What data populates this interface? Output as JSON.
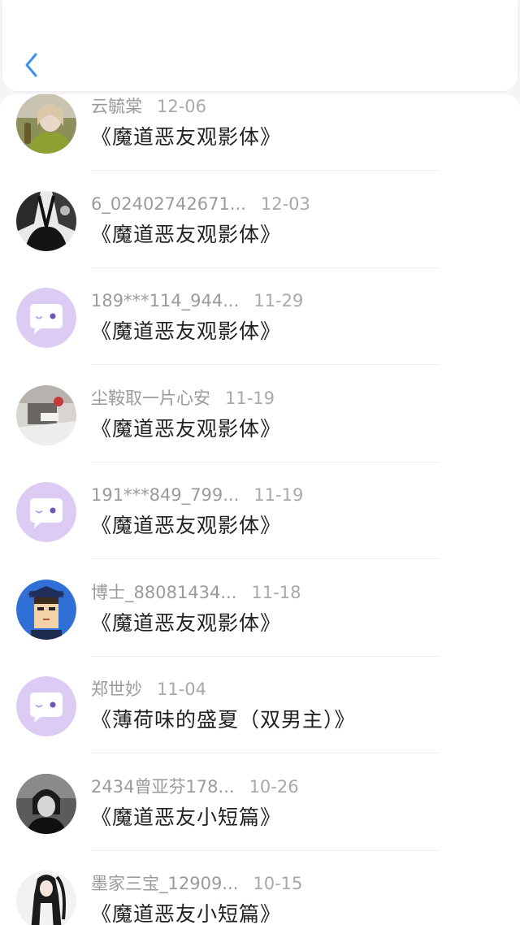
{
  "header": {
    "back_icon": "chevron-left-icon",
    "accent": "#3d8ff0"
  },
  "comments": [
    {
      "user": "云毓棠",
      "date": "12-06",
      "title": "《魔道恶友观影体》",
      "avatar": "photo-woman"
    },
    {
      "user": "6_02402742671...",
      "date": "12-03",
      "title": "《魔道恶友观影体》",
      "avatar": "photo-bw"
    },
    {
      "user": "189***114_944...",
      "date": "11-29",
      "title": "《魔道恶友观影体》",
      "avatar": "default"
    },
    {
      "user": "尘鞍取一片心安",
      "date": "11-19",
      "title": "《魔道恶友观影体》",
      "avatar": "photo-room"
    },
    {
      "user": "191***849_799...",
      "date": "11-19",
      "title": "《魔道恶友观影体》",
      "avatar": "default"
    },
    {
      "user": "博士_88081434...",
      "date": "11-18",
      "title": "《魔道恶友观影体》",
      "avatar": "pixel-doctor"
    },
    {
      "user": "郑世妙",
      "date": "11-04",
      "title": "《薄荷味的盛夏（双男主）》",
      "avatar": "default"
    },
    {
      "user": "2434曾亚芬178...",
      "date": "10-26",
      "title": "《魔道恶友小短篇》",
      "avatar": "photo-dark"
    },
    {
      "user": "墨家三宝_12909...",
      "date": "10-15",
      "title": "《魔道恶友小短篇》",
      "avatar": "anime-girl"
    }
  ],
  "default_avatar_color": "#dccbf3"
}
